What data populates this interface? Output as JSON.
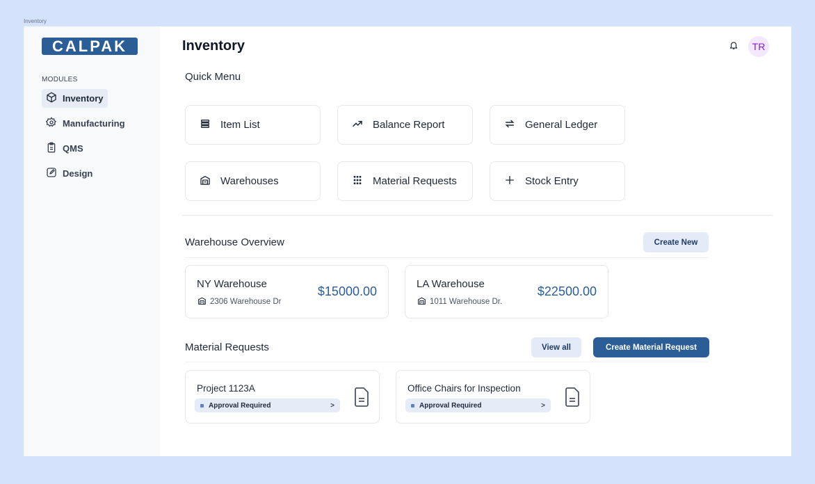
{
  "frame_label": "Inventory",
  "brand": {
    "logo_text": "CALPAK",
    "color": "#2b5d97"
  },
  "sidebar": {
    "section_label": "MODULES",
    "items": [
      {
        "label": "Inventory",
        "icon": "box-icon",
        "active": true
      },
      {
        "label": "Manufacturing",
        "icon": "gear-icon",
        "active": false
      },
      {
        "label": "QMS",
        "icon": "clipboard-icon",
        "active": false
      },
      {
        "label": "Design",
        "icon": "edit-icon",
        "active": false
      }
    ]
  },
  "header": {
    "title": "Inventory",
    "avatar_initials": "TR"
  },
  "quick_menu": {
    "title": "Quick Menu",
    "items": [
      {
        "label": "Item List",
        "icon": "list-icon"
      },
      {
        "label": "Balance Report",
        "icon": "trending-up-icon"
      },
      {
        "label": "General Ledger",
        "icon": "swap-icon"
      },
      {
        "label": "Warehouses",
        "icon": "warehouse-icon"
      },
      {
        "label": "Material Requests",
        "icon": "grid-icon"
      },
      {
        "label": "Stock Entry",
        "icon": "plus-icon"
      }
    ]
  },
  "warehouse_overview": {
    "title": "Warehouse Overview",
    "create_label": "Create New",
    "warehouses": [
      {
        "name": "NY Warehouse",
        "address": "2306 Warehouse Dr",
        "amount": "$15000.00"
      },
      {
        "name": "LA Warehouse",
        "address": "1011 Warehouse Dr.",
        "amount": "$22500.00"
      }
    ]
  },
  "material_requests": {
    "title": "Material Requests",
    "view_all_label": "View all",
    "create_label": "Create Material Request",
    "requests": [
      {
        "name": "Project 1123A",
        "status": "Approval Required",
        "chevron": ">"
      },
      {
        "name": "Office Chairs for Inspection",
        "status": "Approval Required",
        "chevron": ">"
      }
    ]
  }
}
